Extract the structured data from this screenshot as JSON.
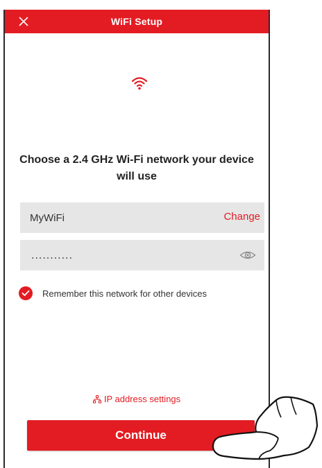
{
  "header": {
    "title": "WiFi Setup",
    "close_icon": "close-icon"
  },
  "main": {
    "wifi_icon": "wifi-icon",
    "heading": "Choose a 2.4 GHz Wi-Fi network your device will use",
    "network": {
      "ssid_value": "MyWiFi",
      "change_label": "Change"
    },
    "password": {
      "value": "...........",
      "visibility_icon": "eye-icon"
    },
    "remember": {
      "checked": true,
      "label": "Remember this network for other devices"
    },
    "ip_settings": {
      "icon": "network-icon",
      "label": "IP address settings"
    },
    "continue_label": "Continue"
  },
  "colors": {
    "accent": "#e31c23",
    "field_bg": "#e6e6e6",
    "text": "#222222"
  }
}
